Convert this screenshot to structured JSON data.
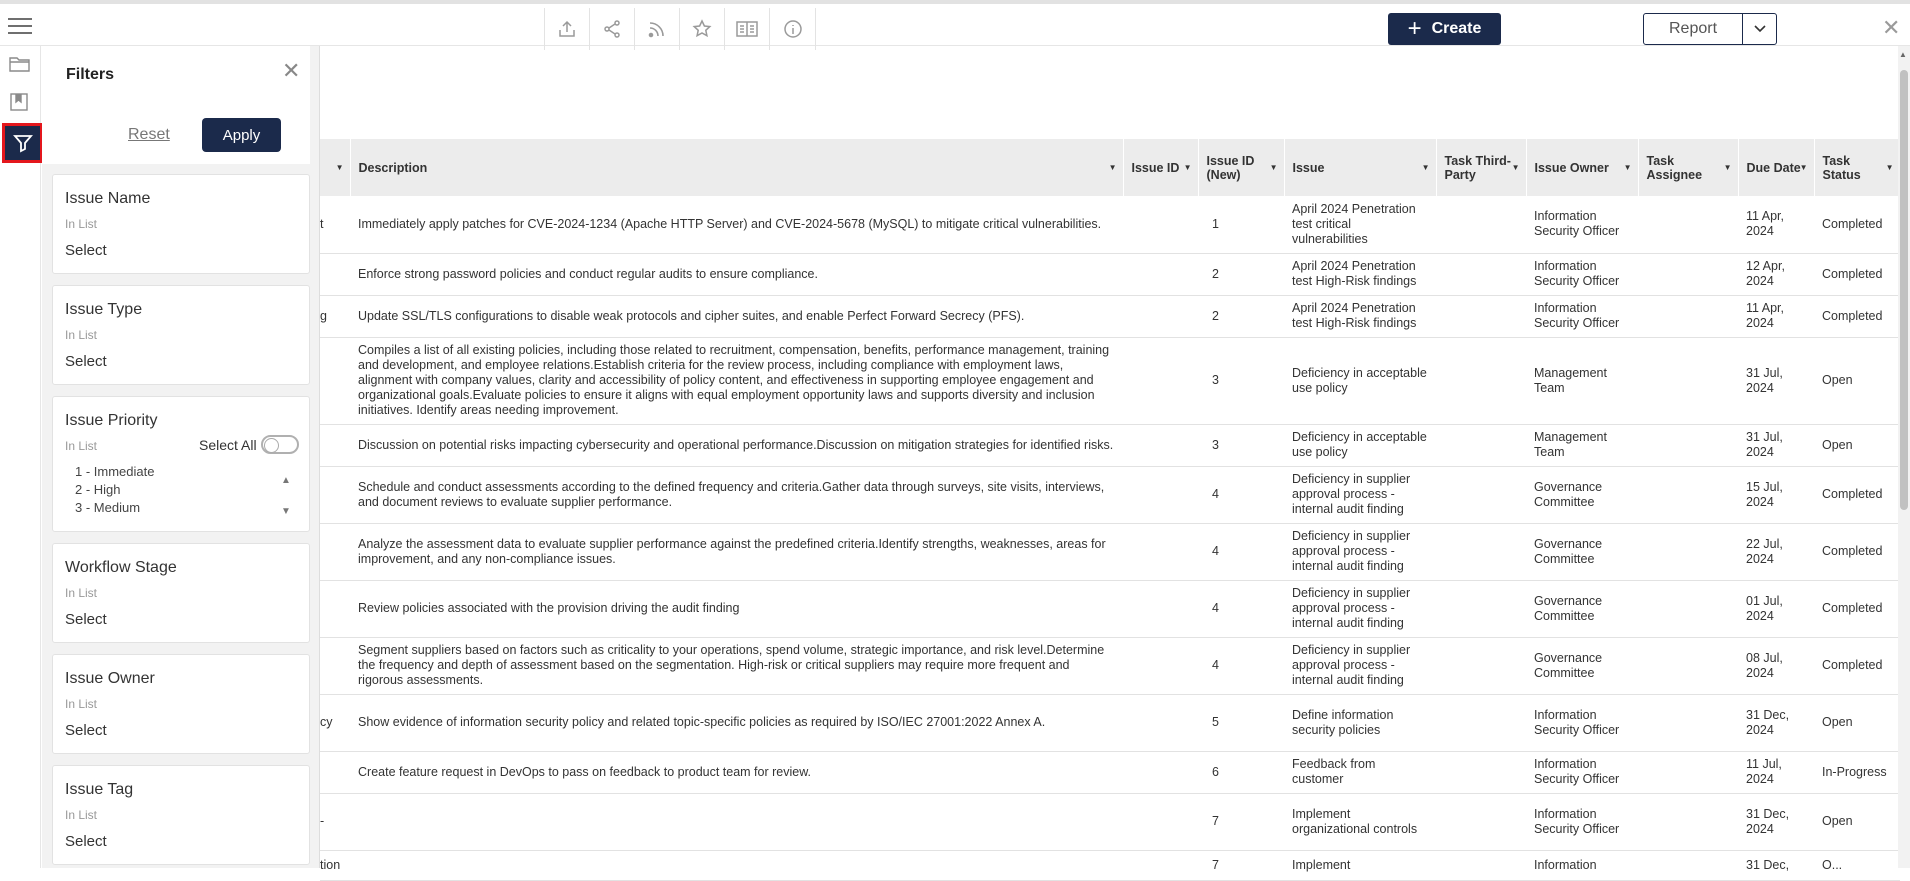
{
  "filters": {
    "title": "Filters",
    "reset_label": "Reset",
    "apply_label": "Apply",
    "cards": [
      {
        "title": "Issue Name",
        "operator": "In List",
        "select_label": "Select"
      },
      {
        "title": "Issue Type",
        "operator": "In List",
        "select_label": "Select"
      },
      {
        "title": "Issue Priority",
        "operator": "In List",
        "select_all_label": "Select All",
        "options": [
          "1 - Immediate",
          "2 - High",
          "3 - Medium"
        ]
      },
      {
        "title": "Workflow Stage",
        "operator": "In List",
        "select_label": "Select"
      },
      {
        "title": "Issue Owner",
        "operator": "In List",
        "select_label": "Select"
      },
      {
        "title": "Issue Tag",
        "operator": "In List",
        "select_label": "Select"
      }
    ]
  },
  "toolbar": {
    "create_label": "Create",
    "report_label": "Report",
    "icons": [
      "upload-icon",
      "share-icon",
      "rss-icon",
      "star-icon",
      "reader-icon",
      "info-icon"
    ]
  },
  "table": {
    "columns": [
      "",
      "Description",
      "Issue ID",
      "Issue ID (New)",
      "Issue",
      "Task Third-Party",
      "Issue Owner",
      "Task Assignee",
      "Due Date",
      "Task Status"
    ],
    "rows": [
      {
        "c0": "t",
        "description": "Immediately apply patches for CVE-2024-1234 (Apache HTTP Server) and CVE-2024-5678 (MySQL) to mitigate critical vulnerabilities.",
        "issue_id": "",
        "issue_id_new": "1",
        "issue": "April 2024 Penetration test critical vulnerabilities",
        "third_party": "",
        "owner": "Information Security Officer",
        "assignee": "",
        "due": "11 Apr, 2024",
        "status": "Completed"
      },
      {
        "c0": "",
        "description": "Enforce strong password policies and conduct regular audits to ensure compliance.",
        "issue_id": "",
        "issue_id_new": "2",
        "issue": "April 2024 Penetration test High-Risk findings",
        "third_party": "",
        "owner": "Information Security Officer",
        "assignee": "",
        "due": "12 Apr, 2024",
        "status": "Completed"
      },
      {
        "c0": "g",
        "description": "Update SSL/TLS configurations to disable weak protocols and cipher suites, and enable Perfect Forward Secrecy (PFS).",
        "issue_id": "",
        "issue_id_new": "2",
        "issue": "April 2024 Penetration test High-Risk findings",
        "third_party": "",
        "owner": "Information Security Officer",
        "assignee": "",
        "due": "11 Apr, 2024",
        "status": "Completed"
      },
      {
        "c0": "",
        "description": "Compiles a list of all existing policies, including those related to recruitment, compensation, benefits, performance management, training and development, and employee relations.Establish criteria for the review process, including compliance with employment laws, alignment with company values, clarity and accessibility of policy content, and effectiveness in supporting employee engagement and organizational goals.Evaluate policies to ensure it aligns with equal employment opportunity laws and supports diversity and inclusion initiatives. Identify areas needing improvement.",
        "issue_id": "",
        "issue_id_new": "3",
        "issue": "Deficiency in acceptable use policy",
        "third_party": "",
        "owner": "Management Team",
        "assignee": "",
        "due": "31 Jul, 2024",
        "status": "Open"
      },
      {
        "c0": "",
        "description": "Discussion on potential risks impacting cybersecurity and operational performance.Discussion on mitigation strategies for identified risks.",
        "issue_id": "",
        "issue_id_new": "3",
        "issue": "Deficiency in acceptable use policy",
        "third_party": "",
        "owner": "Management Team",
        "assignee": "",
        "due": "31 Jul, 2024",
        "status": "Open"
      },
      {
        "c0": "",
        "description": "Schedule and conduct assessments according to the defined frequency and criteria.Gather data through surveys, site visits, interviews, and document reviews to evaluate supplier performance.",
        "issue_id": "",
        "issue_id_new": "4",
        "issue": "Deficiency in supplier approval process - internal audit finding",
        "third_party": "",
        "owner": "Governance Committee",
        "assignee": "",
        "due": "15 Jul, 2024",
        "status": "Completed"
      },
      {
        "c0": "",
        "description": "Analyze the assessment data to evaluate supplier performance against the predefined criteria.Identify strengths, weaknesses, areas for improvement, and any non-compliance issues.",
        "issue_id": "",
        "issue_id_new": "4",
        "issue": "Deficiency in supplier approval process - internal audit finding",
        "third_party": "",
        "owner": "Governance Committee",
        "assignee": "",
        "due": "22 Jul, 2024",
        "status": "Completed"
      },
      {
        "c0": "",
        "description": "Review policies associated with the provision driving the audit finding",
        "issue_id": "",
        "issue_id_new": "4",
        "issue": "Deficiency in supplier approval process - internal audit finding",
        "third_party": "",
        "owner": "Governance Committee",
        "assignee": "",
        "due": "01 Jul, 2024",
        "status": "Completed"
      },
      {
        "c0": "",
        "description": "Segment suppliers based on factors such as criticality to your operations, spend volume, strategic importance, and risk level.Determine the frequency and depth of assessment based on the segmentation. High-risk or critical suppliers may require more frequent and rigorous assessments.",
        "issue_id": "",
        "issue_id_new": "4",
        "issue": "Deficiency in supplier approval process - internal audit finding",
        "third_party": "",
        "owner": "Governance Committee",
        "assignee": "",
        "due": "08 Jul, 2024",
        "status": "Completed"
      },
      {
        "c0": "cy",
        "description": "Show evidence of information security policy and related topic-specific policies as required by ISO/IEC 27001:2022 Annex A.",
        "issue_id": "",
        "issue_id_new": "5",
        "issue": "Define information security policies",
        "third_party": "",
        "owner": "Information Security Officer",
        "assignee": "",
        "due": "31 Dec, 2024",
        "status": "Open"
      },
      {
        "c0": "",
        "description": "Create feature request in DevOps to pass on feedback to product team for review.",
        "issue_id": "",
        "issue_id_new": "6",
        "issue": "Feedback from customer",
        "third_party": "",
        "owner": "Information Security Officer",
        "assignee": "",
        "due": "11 Jul, 2024",
        "status": "In-Progress"
      },
      {
        "c0": "-",
        "description": "",
        "issue_id": "",
        "issue_id_new": "7",
        "issue": "Implement organizational controls",
        "third_party": "",
        "owner": "Information Security Officer",
        "assignee": "",
        "due": "31 Dec, 2024",
        "status": "Open"
      },
      {
        "c0": "tion",
        "description": "",
        "issue_id": "",
        "issue_id_new": "7",
        "issue": "Implement",
        "third_party": "",
        "owner": "Information",
        "assignee": "",
        "due": "31 Dec,",
        "status": "O..."
      }
    ]
  }
}
